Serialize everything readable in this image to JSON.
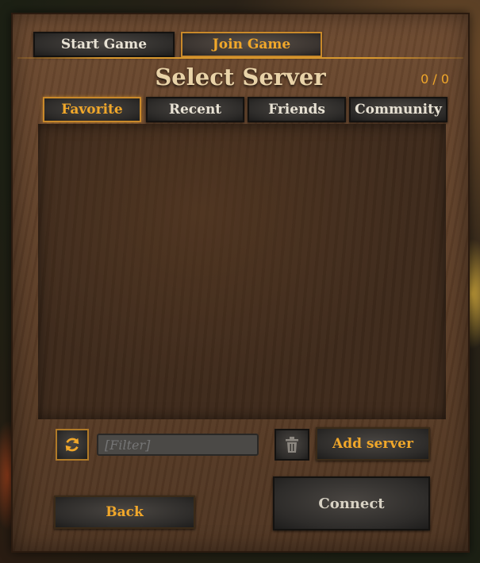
{
  "mode_tabs": [
    {
      "label": "Start Game",
      "selected": false
    },
    {
      "label": "Join Game",
      "selected": true
    }
  ],
  "header": {
    "title": "Select Server",
    "count": "0 / 0"
  },
  "server_tabs": [
    {
      "label": "Favorite",
      "selected": true
    },
    {
      "label": "Recent",
      "selected": false
    },
    {
      "label": "Friends",
      "selected": false
    },
    {
      "label": "Community",
      "selected": false
    }
  ],
  "filter": {
    "placeholder": "[Filter]",
    "value": ""
  },
  "actions": {
    "add_server": "Add server",
    "back": "Back",
    "connect": "Connect"
  },
  "icons": {
    "refresh": "refresh-icon",
    "delete": "trash-icon"
  },
  "colors": {
    "accent": "#f0a72a",
    "panel": "#5e3f28",
    "button": "#2e2c2a",
    "title": "#e9d3a8"
  }
}
